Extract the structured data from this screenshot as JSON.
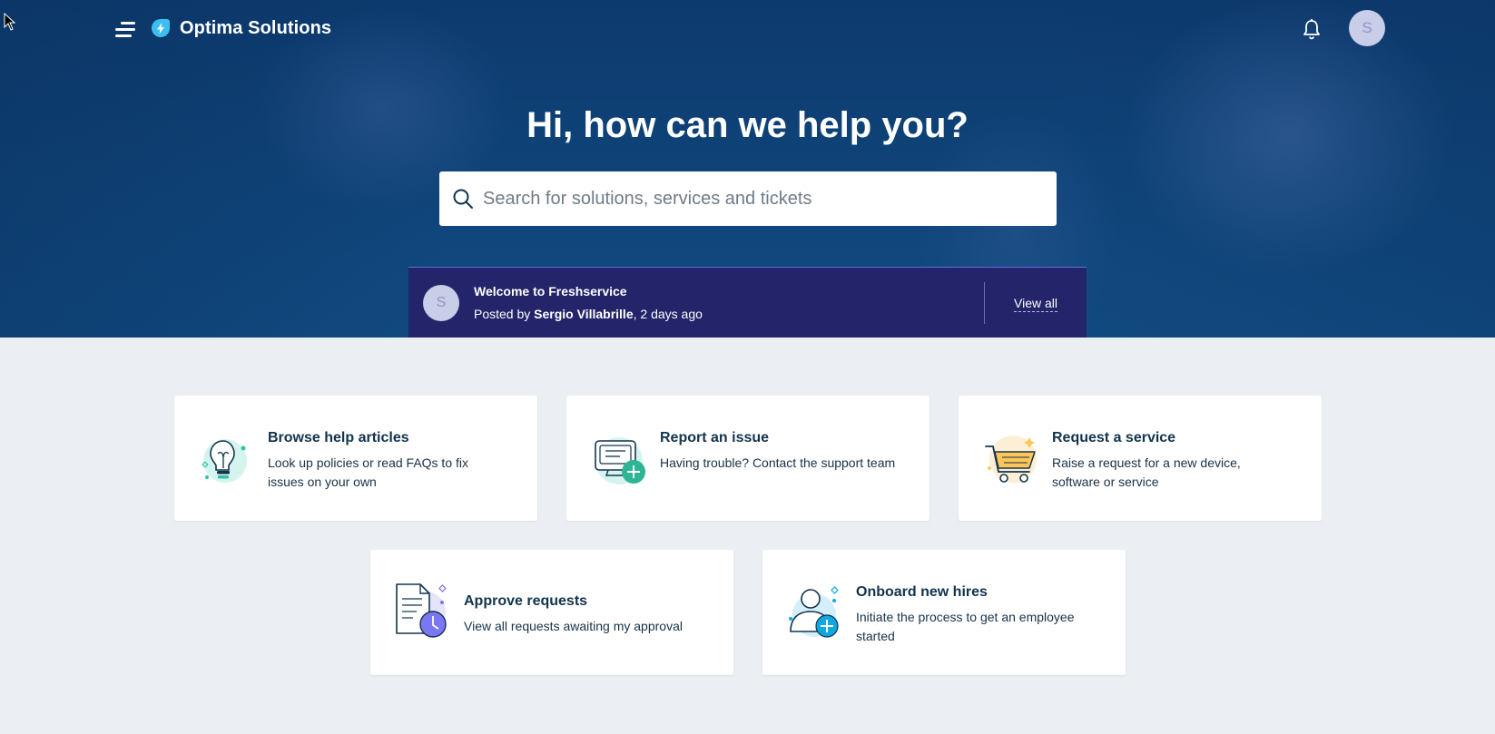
{
  "header": {
    "brand": "Optima Solutions",
    "avatar_initial": "S",
    "icons": [
      "hamburger-menu-icon",
      "bolt-logo-icon",
      "bell-icon"
    ]
  },
  "hero": {
    "title": "Hi, how can we help you?",
    "search_placeholder": "Search for solutions, services and tickets"
  },
  "announcement": {
    "avatar_initial": "S",
    "title": "Welcome to Freshservice",
    "posted_by_prefix": "Posted by ",
    "author": "Sergio Villabrille",
    "time": ", 2 days ago",
    "view_all": "View all"
  },
  "cards": [
    {
      "title": "Browse help articles",
      "description": "Look up policies or read FAQs to fix issues on your own",
      "icon": "lightbulb-icon"
    },
    {
      "title": "Report an issue",
      "description": "Having trouble? Contact the support team",
      "icon": "report-issue-icon"
    },
    {
      "title": "Request a service",
      "description": "Raise a request for a new device, software or service",
      "icon": "shopping-cart-icon"
    },
    {
      "title": "Approve requests",
      "description": "View all requests awaiting my approval",
      "icon": "document-clock-icon"
    },
    {
      "title": "Onboard new hires",
      "description": "Initiate the process to get an employee started",
      "icon": "add-user-icon"
    }
  ],
  "colors": {
    "hero_bg": "#0f4479",
    "announcement_bg": "#24246a",
    "page_bg": "#ebeff3",
    "text_dark": "#12344d"
  }
}
